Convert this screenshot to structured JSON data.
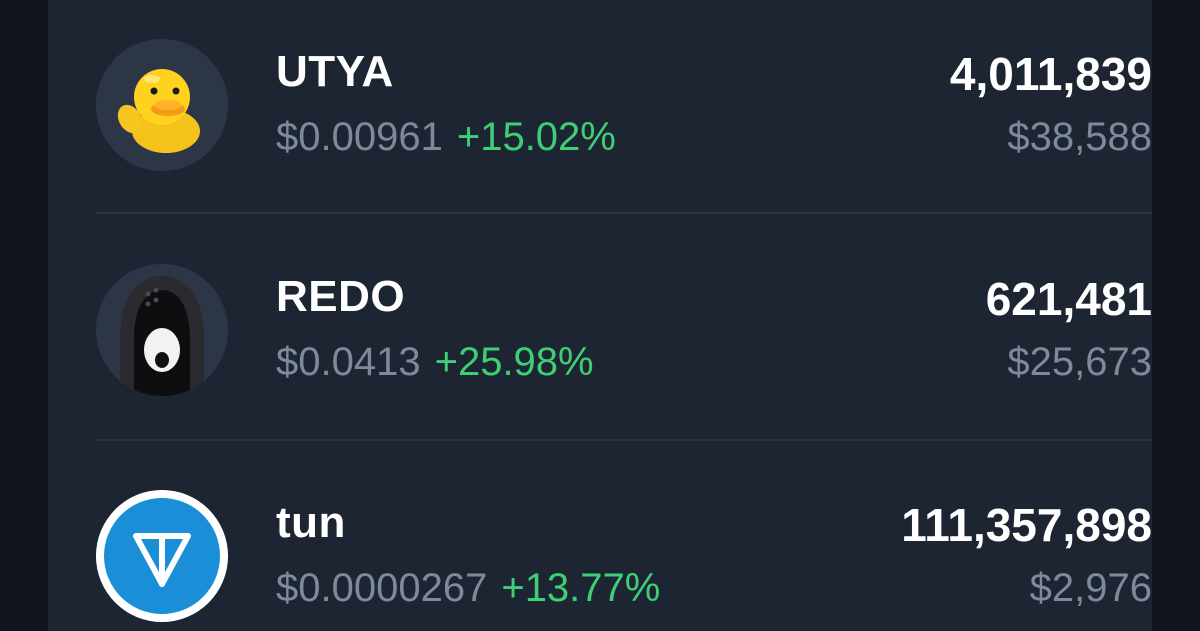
{
  "tokens": [
    {
      "name": "UTYA",
      "price": "$0.00961",
      "change": "+15.02%",
      "amount": "4,011,839",
      "value": "$38,588",
      "icon": "duck-icon"
    },
    {
      "name": "REDO",
      "price": "$0.0413",
      "change": "+25.98%",
      "amount": "621,481",
      "value": "$25,673",
      "icon": "hooded-figure-icon"
    },
    {
      "name": "tun",
      "price": "$0.0000267",
      "change": "+13.77%",
      "amount": "111,357,898",
      "value": "$2,976",
      "icon": "ton-diamond-icon"
    }
  ],
  "colors": {
    "background": "#12161c",
    "panel": "#1d2532",
    "primary_text": "#ffffff",
    "secondary_text": "#7e8a9a",
    "positive_change": "#3ecf76",
    "ton_blue": "#1a8fd8"
  }
}
